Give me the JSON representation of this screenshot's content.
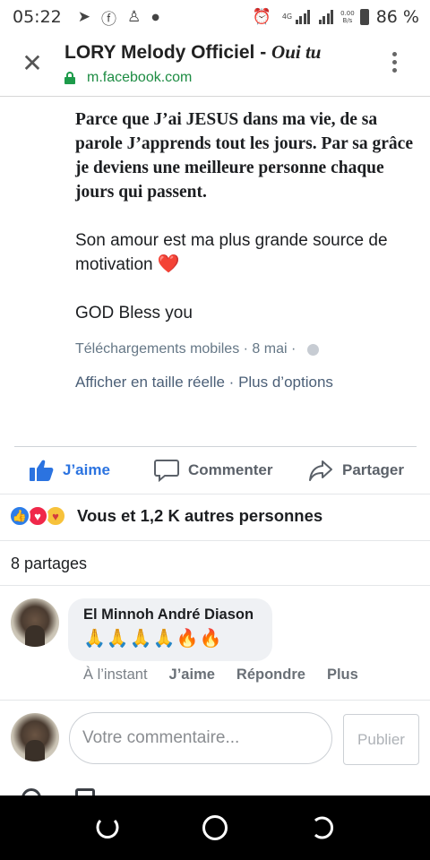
{
  "status_bar": {
    "time": "05:22",
    "network": "4G",
    "speed_top": "0.00",
    "speed_bottom": "B/s",
    "battery": "86 %"
  },
  "browser": {
    "title_main": "LORY Melody Officiel - ",
    "title_italic": "Oui tu",
    "url": "m.facebook.com",
    "icons": {
      "close": "close-icon",
      "lock": "lock-icon",
      "menu": "more-vert-icon"
    }
  },
  "post": {
    "serif_paragraph": "Parce que J’ai JESUS dans ma vie, de sa parole J’apprends tout les jours. Par sa grâce je deviens une meilleure personne chaque jours qui passent.",
    "paragraph_2": "Son amour est ma plus grande source de motivation",
    "paragraph_2_emoji": "❤️",
    "paragraph_3": "GOD Bless you",
    "meta_album": "Téléchargements mobiles",
    "meta_sep": " · ",
    "meta_date": "8 mai",
    "meta_sep2": " · ",
    "link_full_size": "Afficher en taille réelle",
    "link_sep": " · ",
    "link_more_options": "Plus d’options"
  },
  "actions": {
    "like": "J’aime",
    "comment": "Commenter",
    "share": "Partager"
  },
  "reactions": {
    "summary": "Vous et 1,2 K autres personnes",
    "types": [
      "like",
      "love",
      "care"
    ],
    "colors": {
      "like": "#2b7de9",
      "love": "#f0284a",
      "care": "#f7c23b"
    }
  },
  "shares": "8 partages",
  "comment": {
    "author": "El Minnoh André Diason",
    "text": "🙏🙏🙏🙏🔥🔥",
    "time": "À l’instant",
    "like": "J’aime",
    "reply": "Répondre",
    "more": "Plus"
  },
  "compose": {
    "placeholder": "Votre commentaire...",
    "publish": "Publier"
  }
}
